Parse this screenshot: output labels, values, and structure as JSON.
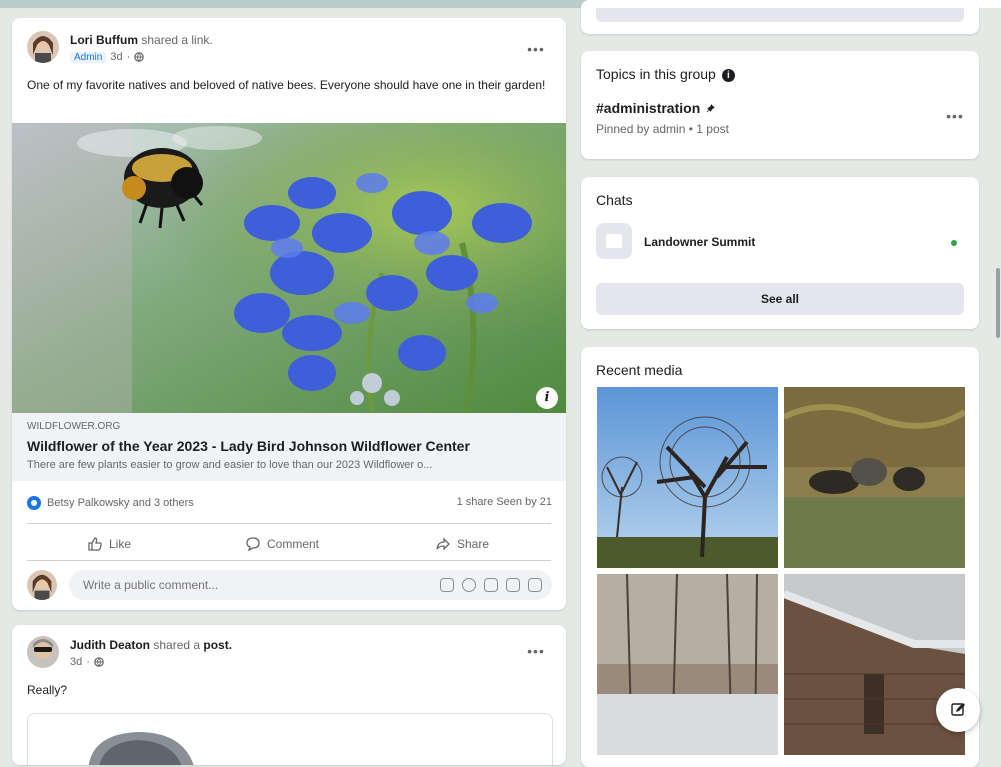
{
  "post1": {
    "author": "Lori Buffum",
    "action_text": "shared a link.",
    "badge": "Admin",
    "time": "3d",
    "more": "•••",
    "text": "One of my favorite natives and beloved of native bees. Everyone should have one in their garden!",
    "link": {
      "domain": "WILDFLOWER.ORG",
      "title": "Wildflower of the Year 2023 - Lady Bird Johnson Wildflower Center",
      "description": "There are few plants easier to grow and easier to love than our 2023 Wildflower o..."
    },
    "reactions_text": "Betsy Palkowsky and 3 others",
    "share_stats": "1 share   Seen by 21",
    "actions": {
      "like": "Like",
      "comment": "Comment",
      "share": "Share"
    },
    "comment_placeholder": "Write a public comment..."
  },
  "post2": {
    "author": "Judith Deaton",
    "action_text": "shared a",
    "action_object": "post.",
    "time": "3d",
    "more": "•••",
    "text": "Really?"
  },
  "sidebar": {
    "topics": {
      "title": "Topics in this group",
      "tag": "#administration",
      "sub": "Pinned by admin • 1 post",
      "more": "•••"
    },
    "chats": {
      "title": "Chats",
      "items": [
        {
          "name": "Landowner Summit"
        }
      ],
      "see_all": "See all"
    },
    "media": {
      "title": "Recent media"
    }
  },
  "icons": {
    "info": "info-icon",
    "like": "thumbs-up-icon",
    "comment": "speech-bubble-icon",
    "share": "share-arrow-icon",
    "compose": "pencil-icon",
    "globe": "globe-icon"
  },
  "colors": {
    "accent": "#1b74e4",
    "online": "#31a24c",
    "background": "#e4e9e6"
  }
}
